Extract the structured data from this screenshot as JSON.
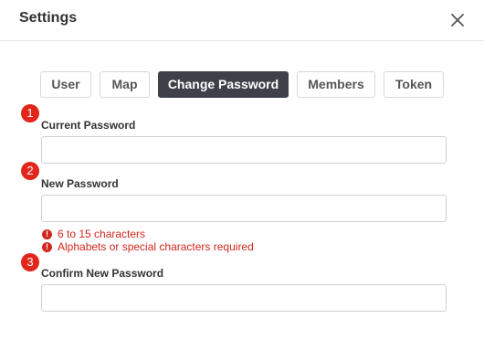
{
  "dialog": {
    "title": "Settings",
    "close_icon": "close-icon"
  },
  "tabs": [
    {
      "label": "User",
      "active": false
    },
    {
      "label": "Map",
      "active": false
    },
    {
      "label": "Change Password",
      "active": true
    },
    {
      "label": "Members",
      "active": false
    },
    {
      "label": "Token",
      "active": false
    }
  ],
  "markers": [
    "1",
    "2",
    "3"
  ],
  "form": {
    "current_password": {
      "label": "Current Password",
      "value": "",
      "placeholder": ""
    },
    "new_password": {
      "label": "New Password",
      "value": "",
      "placeholder": ""
    },
    "confirm_password": {
      "label": "Confirm New Password",
      "value": "",
      "placeholder": ""
    },
    "errors": [
      "6 to 15 characters",
      "Alphabets or special characters required"
    ],
    "error_icon": "exclamation-circle-icon"
  },
  "colors": {
    "active_tab": "#3e4149",
    "marker": "#e2261c",
    "error": "#d0281e"
  }
}
